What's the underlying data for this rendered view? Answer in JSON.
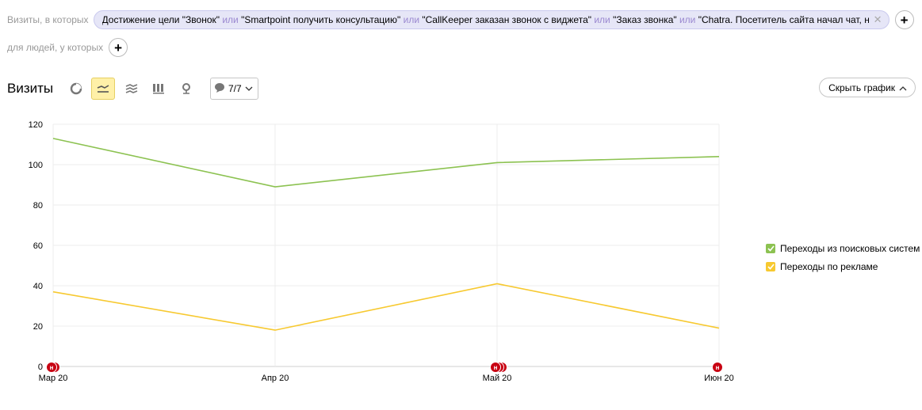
{
  "filters": {
    "visits_label": "Визиты, в которых",
    "people_label": "для людей, у которых",
    "conditions": [
      "Достижение цели \"Звонок\"",
      "\"Smartpoint получить консультацию\"",
      "\"CallKeeper заказан звонок с виджета\"",
      "\"Заказ звонка\"",
      "\"Chatra. Посетитель сайта начал чат, напис…"
    ],
    "or_label": "или",
    "clear_icon": "close-icon",
    "add_icon": "plus-icon"
  },
  "toolbar": {
    "title": "Визиты",
    "chart_types": [
      "pie-chart-icon",
      "line-chart-icon",
      "stacked-area-icon",
      "column-chart-icon",
      "map-icon"
    ],
    "active_chart_type": "line-chart-icon",
    "series_selector": "7/7",
    "hide_chart": "Скрыть график"
  },
  "colors": {
    "search": "#8cc251",
    "ads": "#f7c930",
    "active_tool": "#fff0a8",
    "annotation": "#c80012"
  },
  "annotation_marker": "н",
  "chart_data": {
    "type": "line",
    "x": [
      "Мар 20",
      "Апр 20",
      "Май 20",
      "Июн 20"
    ],
    "series": [
      {
        "name": "Переходы из поисковых систем",
        "color": "#8cc251",
        "values": [
          113,
          89,
          101,
          104
        ]
      },
      {
        "name": "Переходы по рекламе",
        "color": "#f7c930",
        "values": [
          37,
          18,
          41,
          19
        ]
      }
    ],
    "yticks": [
      0,
      20,
      40,
      60,
      80,
      100,
      120
    ],
    "ylim": [
      0,
      120
    ],
    "grid": true,
    "legend": "right",
    "annotations": [
      {
        "x": "Мар 20",
        "count": 2
      },
      {
        "x": "Май 20",
        "count": 3
      },
      {
        "x": "Июн 20",
        "count": 1
      }
    ]
  }
}
